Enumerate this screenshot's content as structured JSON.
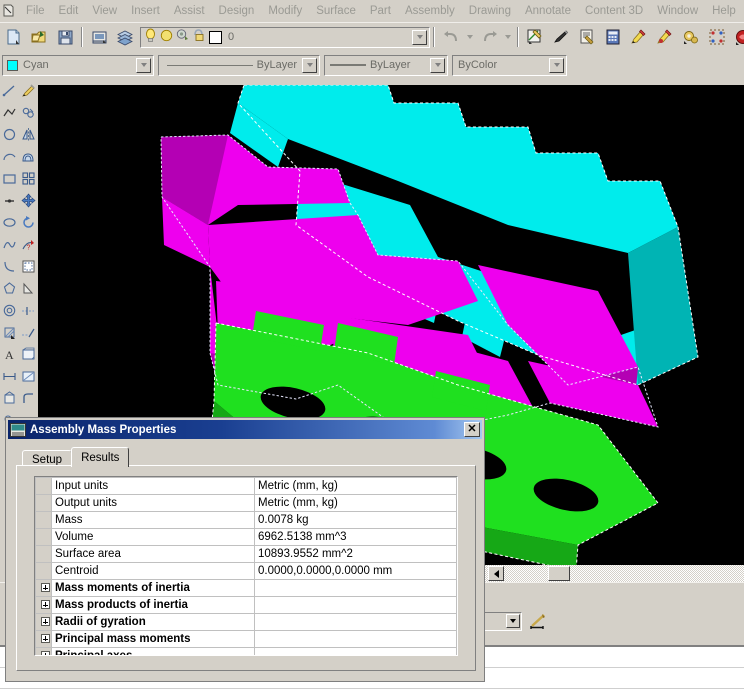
{
  "window": {
    "app_icon": "cad-app-icon"
  },
  "menubar": {
    "items": [
      {
        "label": "File",
        "name": "menu-file"
      },
      {
        "label": "Edit",
        "name": "menu-edit"
      },
      {
        "label": "View",
        "name": "menu-view"
      },
      {
        "label": "Insert",
        "name": "menu-insert"
      },
      {
        "label": "Assist",
        "name": "menu-assist"
      },
      {
        "label": "Design",
        "name": "menu-design"
      },
      {
        "label": "Modify",
        "name": "menu-modify"
      },
      {
        "label": "Surface",
        "name": "menu-surface"
      },
      {
        "label": "Part",
        "name": "menu-part"
      },
      {
        "label": "Assembly",
        "name": "menu-assembly"
      },
      {
        "label": "Drawing",
        "name": "menu-drawing"
      },
      {
        "label": "Annotate",
        "name": "menu-annotate"
      },
      {
        "label": "Content 3D",
        "name": "menu-content-3d"
      },
      {
        "label": "Window",
        "name": "menu-window"
      },
      {
        "label": "Help",
        "name": "menu-help"
      }
    ]
  },
  "toolbar": {
    "buttons": [
      {
        "name": "new-document-icon"
      },
      {
        "name": "open-folder-icon"
      },
      {
        "name": "save-disk-icon"
      },
      {
        "name": "print-icon"
      },
      {
        "name": "layers-icon"
      }
    ],
    "right_buttons": [
      {
        "name": "undo-icon"
      },
      {
        "name": "redo-icon"
      },
      {
        "name": "edit-entity-icon"
      },
      {
        "name": "pen-icon"
      },
      {
        "name": "properties-icon"
      },
      {
        "name": "calculator-icon"
      },
      {
        "name": "highlight-yellow-icon"
      },
      {
        "name": "highlight-red-icon"
      },
      {
        "name": "gears-icon"
      },
      {
        "name": "grid-snap-icon"
      },
      {
        "name": "render-icon"
      },
      {
        "name": "snowflake-icon"
      }
    ],
    "layer_combo": {
      "name": "layer-combo",
      "layer_name": "0",
      "icons": [
        {
          "name": "lightbulb-on-icon"
        },
        {
          "name": "lightbulb-off-icon"
        },
        {
          "name": "layer-freeze-icon"
        },
        {
          "name": "layer-lock-icon"
        },
        {
          "name": "layer-color-swatch-icon"
        }
      ]
    }
  },
  "properties_bar": {
    "color": {
      "name": "color-combo",
      "value": "Cyan",
      "swatch_hex": "#00FFFF"
    },
    "linetype": {
      "name": "linetype-combo",
      "value": "ByLayer"
    },
    "lineweight": {
      "name": "lineweight-combo",
      "value": "ByLayer"
    },
    "printstyle": {
      "name": "printstyle-combo",
      "value": "ByColor"
    }
  },
  "left_palette_a": {
    "items": [
      {
        "name": "line-tool-icon"
      },
      {
        "name": "polyline-tool-icon"
      },
      {
        "name": "circle-tool-icon"
      },
      {
        "name": "arc-tool-icon"
      },
      {
        "name": "rectangle-tool-icon"
      },
      {
        "name": "point-tool-icon"
      },
      {
        "name": "ellipse-tool-icon"
      },
      {
        "name": "spline-tool-icon"
      },
      {
        "name": "curve-tool-icon"
      },
      {
        "name": "polygon-tool-icon"
      },
      {
        "name": "donut-tool-icon"
      },
      {
        "name": "hatch-tool-icon"
      },
      {
        "name": "text-tool-icon"
      },
      {
        "name": "dimension-tool-icon"
      }
    ]
  },
  "left_palette_b": {
    "items": [
      {
        "name": "paint-brush-icon"
      },
      {
        "name": "copy-tool-icon"
      },
      {
        "name": "mirror-tool-icon"
      },
      {
        "name": "offset-tool-icon"
      },
      {
        "name": "array-tool-icon"
      },
      {
        "name": "move-tool-icon"
      },
      {
        "name": "rotate-tool-icon"
      },
      {
        "name": "align-tool-icon"
      },
      {
        "name": "scale-tool-icon"
      },
      {
        "name": "stretch-tool-icon"
      },
      {
        "name": "trim-tool-icon"
      },
      {
        "name": "extend-tool-icon"
      },
      {
        "name": "break-tool-icon"
      },
      {
        "name": "explode-tool-icon"
      }
    ]
  },
  "viewport": {
    "name": "model-3d-viewport",
    "background_hex": "#000000",
    "model_colors": {
      "cyan": "#00F5F5",
      "magenta": "#F000F0",
      "green": "#22E022",
      "selection_outline": "#FFFFFF"
    },
    "selection_state": "selected"
  },
  "scrollbar": {
    "name": "horizontal-scrollbar",
    "left_arrow": "scroll-left-arrow-icon"
  },
  "status_tools": {
    "combo": {
      "name": "dimension-style-combo",
      "value": ""
    },
    "dim_button": {
      "name": "dimension-tool-button",
      "icon": "dimension-icon"
    }
  },
  "dialog": {
    "name": "assembly-mass-properties-dialog",
    "title": "Assembly Mass Properties",
    "icon": "mass-properties-icon",
    "close_label": "✕",
    "tabs": [
      {
        "label": "Setup",
        "name": "tab-setup",
        "active": false
      },
      {
        "label": "Results",
        "name": "tab-results",
        "active": true
      }
    ],
    "grid": {
      "name": "mass-properties-grid",
      "rows": [
        {
          "expandable": false,
          "label": "Input units",
          "value": "Metric (mm, kg)"
        },
        {
          "expandable": false,
          "label": "Output units",
          "value": "Metric (mm, kg)"
        },
        {
          "expandable": false,
          "label": "Mass",
          "value": "0.0078 kg"
        },
        {
          "expandable": false,
          "label": "Volume",
          "value": "6962.5138 mm^3"
        },
        {
          "expandable": false,
          "label": "Surface area",
          "value": "10893.9552 mm^2"
        },
        {
          "expandable": false,
          "label": "Centroid",
          "value": "0.0000,0.0000,0.0000 mm"
        },
        {
          "expandable": true,
          "label": "Mass moments of inertia",
          "value": ""
        },
        {
          "expandable": true,
          "label": "Mass products of inertia",
          "value": ""
        },
        {
          "expandable": true,
          "label": "Radii of gyration",
          "value": ""
        },
        {
          "expandable": true,
          "label": "Principal mass moments",
          "value": ""
        },
        {
          "expandable": true,
          "label": "Principal axes",
          "value": ""
        }
      ]
    }
  }
}
